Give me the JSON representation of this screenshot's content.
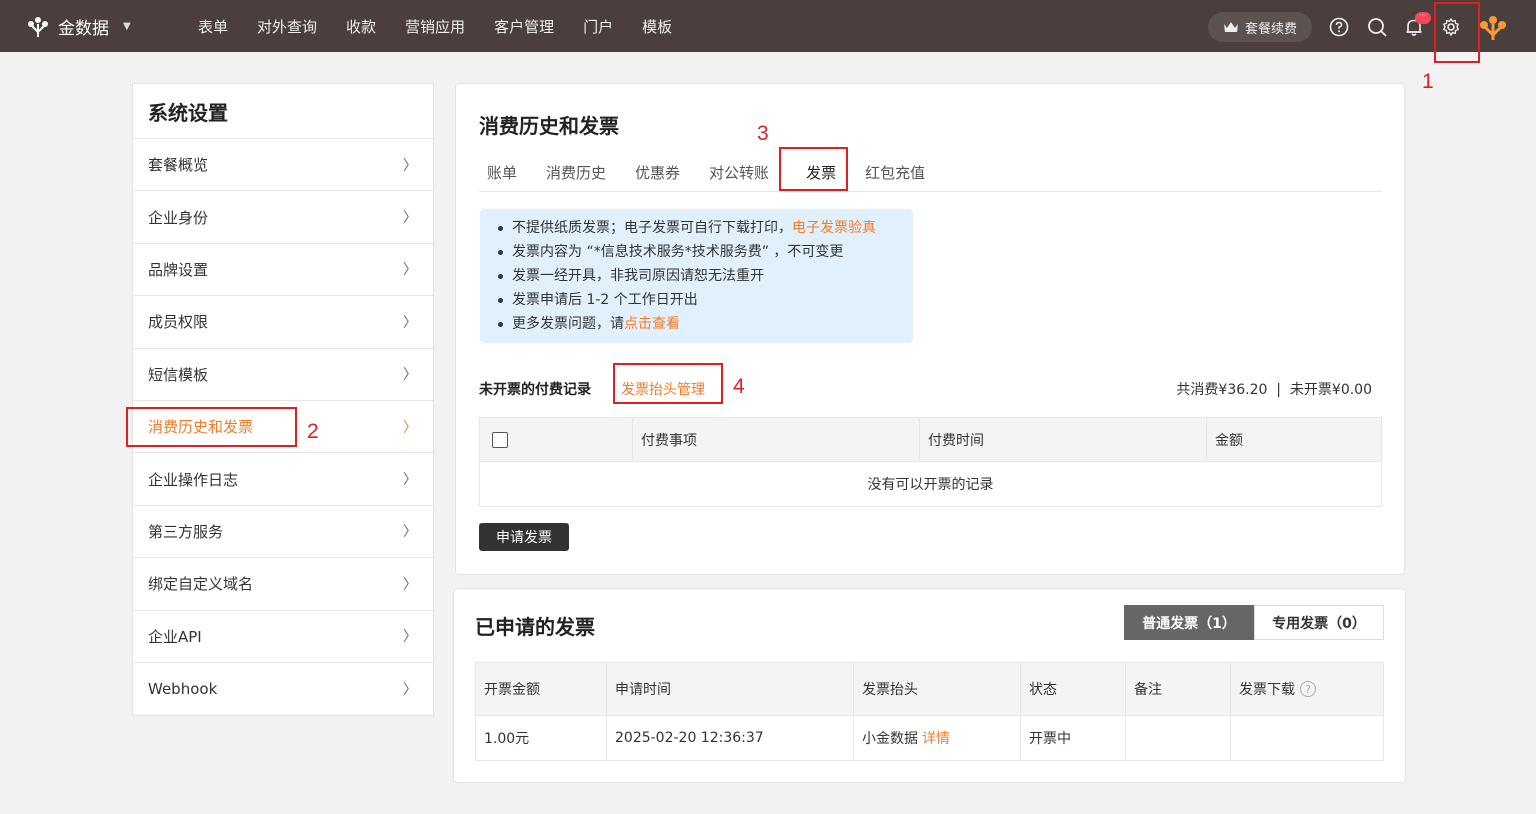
{
  "brand": {
    "name": "金数据"
  },
  "nav": {
    "items": [
      "表单",
      "对外查询",
      "收款",
      "营销应用",
      "客户管理",
      "门户",
      "模板"
    ]
  },
  "topbar": {
    "renew_label": "套餐续费",
    "bell_badge": "···"
  },
  "annotations": {
    "n1": "1",
    "n2": "2",
    "n3": "3",
    "n4": "4"
  },
  "sidebar": {
    "title": "系统设置",
    "items": [
      {
        "label": "套餐概览"
      },
      {
        "label": "企业身份"
      },
      {
        "label": "品牌设置"
      },
      {
        "label": "成员权限"
      },
      {
        "label": "短信模板"
      },
      {
        "label": "消费历史和发票"
      },
      {
        "label": "企业操作日志"
      },
      {
        "label": "第三方服务"
      },
      {
        "label": "绑定自定义域名"
      },
      {
        "label": "企业API"
      },
      {
        "label": "Webhook"
      }
    ],
    "active_index": 5
  },
  "main": {
    "title": "消费历史和发票",
    "tabs": [
      "账单",
      "消费历史",
      "优惠券",
      "对公转账",
      "发票",
      "红包充值"
    ],
    "active_tab": "发票",
    "notice": {
      "line1_text": "不提供纸质发票；电子发票可自行下载打印，",
      "line1_link": "电子发票验真",
      "line2": "发票内容为 “*信息技术服务*技术服务费” ，不可变更",
      "line3": "发票一经开具，非我司原因请恕无法重开",
      "line4": "发票申请后 1-2 个工作日开出",
      "line5_text": "更多发票问题，请",
      "line5_link": "点击查看"
    },
    "unpaid_label": "未开票的付费记录",
    "header_mgmt_link": "发票抬头管理",
    "totals": "共消费¥36.20  |  未开票¥0.00",
    "unpaid_table": {
      "headers": [
        "付费事项",
        "付费时间",
        "金额"
      ],
      "empty_text": "没有可以开票的记录"
    },
    "apply_button": "申请发票"
  },
  "applied": {
    "title": "已申请的发票",
    "seg_normal": "普通发票（1）",
    "seg_special": "专用发票（0）",
    "headers": [
      "开票金额",
      "申请时间",
      "发票抬头",
      "状态",
      "备注",
      "发票下载"
    ],
    "rows": [
      {
        "amount": "1.00元",
        "time": "2025-02-20 12:36:37",
        "header": "小金数据",
        "detail_link": "详情",
        "status": "开票中",
        "remark": "",
        "download": ""
      }
    ]
  },
  "colors": {
    "accent": "#f07c2c",
    "topbar": "#4a3f3c",
    "annotation": "#e02020",
    "notice_bg": "#e0f0fd"
  }
}
